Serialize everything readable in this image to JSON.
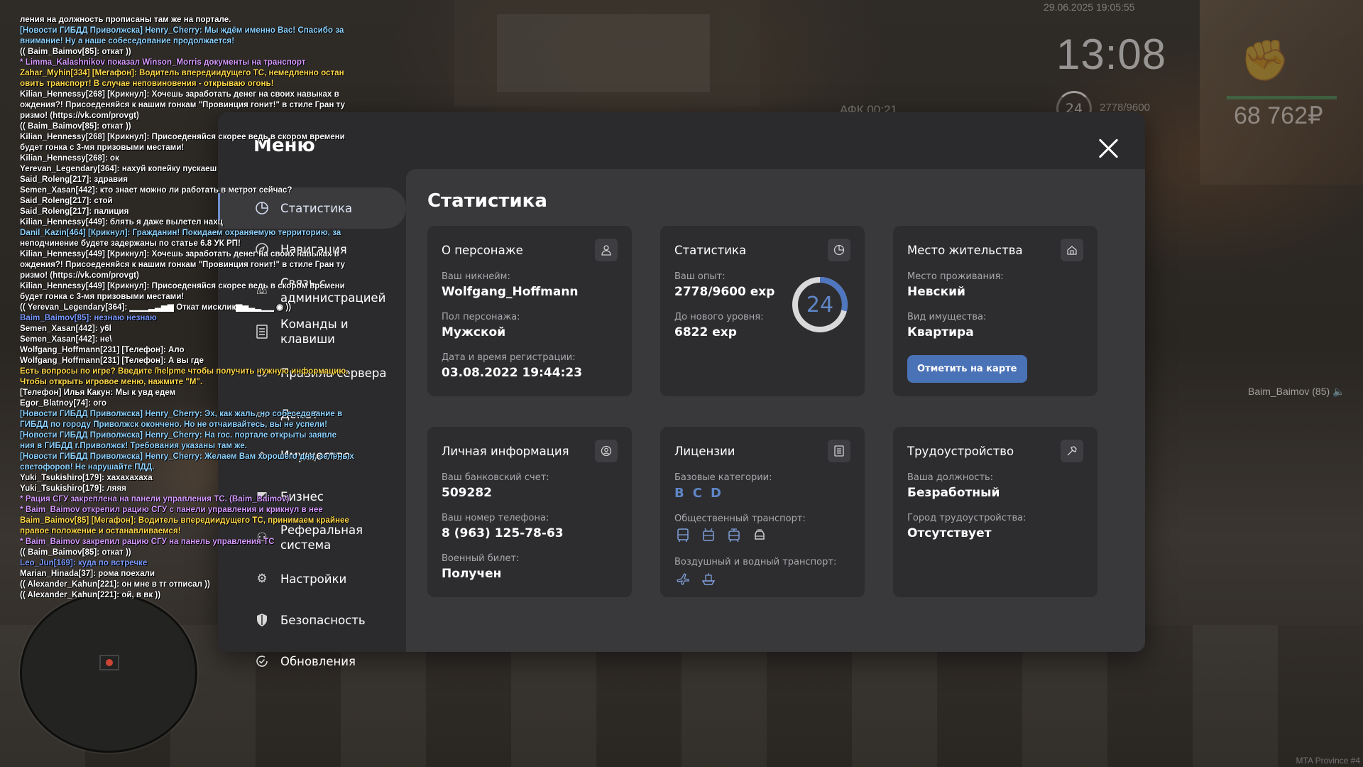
{
  "hud": {
    "datetime": "29.06.2025 19:05:55",
    "clock": "13:08",
    "afk": "АФК 00:21",
    "level": "24",
    "exp": "2778/9600",
    "money": "68 762₽",
    "voice_user": "Baim_Baimov (85)",
    "watermark": "MTA Province #4"
  },
  "chat": [
    {
      "text": "ления на должность прописаны там же на портале.",
      "color": "white"
    },
    {
      "text": "[Новости ГИБДД Приволжска] Henry_Cherry: Мы ждём именно Вас! Спасибо за",
      "color": "cyan"
    },
    {
      "text": " внимание! Ну а наше собеседование продолжается!",
      "color": "cyan"
    },
    {
      "text": "(( Baim_Baimov[85]: откат ))",
      "color": "white"
    },
    {
      "text": "* Limma_Kalashnikov показал Winson_Morris документы на транспорт",
      "color": "purple"
    },
    {
      "text": "Zahar_Myhin[334] [Мегафон]: Водитель впередиидущего ТС, немедленно остан",
      "color": "yellow"
    },
    {
      "text": "овить транспорт! В случае неповиновения - открываю огонь!",
      "color": "yellow"
    },
    {
      "text": "Kilian_Hennessy[268] [Крикнул]: Хочешь заработать денег на своих навыках в",
      "color": "white"
    },
    {
      "text": "ождения?! Присоеденяйся к нашим гонкам \"Провинция гонит!\" в стиле Гран ту",
      "color": "white"
    },
    {
      "text": "ризмо! (https://vk.com/provgt)",
      "color": "white"
    },
    {
      "text": "(( Baim_Baimov[85]: откат ))",
      "color": "white"
    },
    {
      "text": "Kilian_Hennessy[268] [Крикнул]: Присоеденяйся скорее ведь в скором времени",
      "color": "white"
    },
    {
      "text": " будет гонка с 3-мя призовыми местами!",
      "color": "white"
    },
    {
      "text": "Kilian_Hennessy[268]: ок",
      "color": "white"
    },
    {
      "text": "Yerevan_Legendary[364]: нахуй копейку пускаеш",
      "color": "white"
    },
    {
      "text": "Said_Roleng[217]: здравия",
      "color": "white"
    },
    {
      "text": "Semen_Xasan[442]: кто знает можно ли работать в метрот сейчас?",
      "color": "white"
    },
    {
      "text": "Said_Roleng[217]: стой",
      "color": "white"
    },
    {
      "text": "Said_Roleng[217]: палиция",
      "color": "white"
    },
    {
      "text": "Kilian_Hennessy[449]: блять я даже вылетел нахц",
      "color": "white"
    },
    {
      "text": "Danil_Kazin[464] [Крикнул]: Гражданин! Покидаем охраняемую территорию, за",
      "color": "cyan"
    },
    {
      "text": "неподчинение будете задержаны по статье 6.8 УК РП!",
      "color": "white"
    },
    {
      "text": "Kilian_Hennessy[449] [Крикнул]: Хочешь заработать денег на своих навыках в",
      "color": "white"
    },
    {
      "text": "ождения?! Присоеденяйся к нашим гонкам \"Провинция гонит!\" в стиле Гран ту",
      "color": "white"
    },
    {
      "text": "ризмо! (https://vk.com/provgt)",
      "color": "white"
    },
    {
      "text": "Kilian_Hennessy[449] [Крикнул]: Присоеденяйся скорее ведь в скором времени",
      "color": "white"
    },
    {
      "text": " будет гонка с 3-мя призовыми местами!",
      "color": "white"
    },
    {
      "text": "(( Yerevan_Legendary[364]: ▁▁▁▂▃▅▆ Откат мисклик▆▅▃▂▁▁ ◉ ))",
      "color": "white"
    },
    {
      "text": "Baim_Baimov[85]: незнаю незнаю",
      "color": "blue"
    },
    {
      "text": "Semen_Xasan[442]: у6l",
      "color": "white"
    },
    {
      "text": "Semen_Xasan[442]: не\\",
      "color": "white"
    },
    {
      "text": "Wolfgang_Hoffmann[231] [Телефон]: Ало",
      "color": "white"
    },
    {
      "text": "Wolfgang_Hoffmann[231] [Телефон]: А вы где",
      "color": "white"
    },
    {
      "text": "Есть вопросы по игре? Введите /helpme чтобы получить нужную информацию.",
      "color": "yellow"
    },
    {
      "text": "Чтобы открыть игровое меню, нажмите \"M\".",
      "color": "yellow"
    },
    {
      "text": "[Телефон] Илья Какун: Мы к увд едем",
      "color": "white"
    },
    {
      "text": "Egor_Blatnoy[74]: ого",
      "color": "white"
    },
    {
      "text": "[Новости ГИБДД Приволжска] Henry_Cherry: Эх, как жаль, но собеседование в",
      "color": "cyan"
    },
    {
      "text": " ГИБДД по городу Приволжск окончено. Но не отчаивайтесь, вы не успели!",
      "color": "cyan"
    },
    {
      "text": "[Новости ГИБДД Приволжска] Henry_Cherry: На гос. портале открыты заявле",
      "color": "cyan"
    },
    {
      "text": "ния в ГИБДД г.Приволжск! Требования указаны там же.",
      "color": "cyan"
    },
    {
      "text": "[Новости ГИБДД Приволжска] Henry_Cherry: Желаем Вам хорошего дня, зелёных",
      "color": "cyan"
    },
    {
      "text": " светофоров! Не нарушайте ПДД.",
      "color": "cyan"
    },
    {
      "text": "Yuki_Tsukishiro[179]: хахахахаха",
      "color": "white"
    },
    {
      "text": "Yuki_Tsukishiro[179]: ляяя",
      "color": "white"
    },
    {
      "text": "* Рация СГУ закреплена на панели управления ТС. (Baim_Baimov)",
      "color": "purple"
    },
    {
      "text": "* Baim_Baimov открепил рацию СГУ с панели управления и крикнул в нее",
      "color": "purple"
    },
    {
      "text": "Baim_Baimov[85] [Мегафон]: Водитель впередиидущего ТС, принимаем крайнее",
      "color": "yellow"
    },
    {
      "text": "правое положение и останавливаемся!",
      "color": "yellow"
    },
    {
      "text": "* Baim_Baimov закрепил рацию СГУ на панель управления ТС",
      "color": "purple"
    },
    {
      "text": "(( Baim_Baimov[85]: откат ))",
      "color": "white"
    },
    {
      "text": "Leo_Jun[169]: куда по встречке",
      "color": "blue"
    },
    {
      "text": "Marian_Hinada[37]: рома поехали",
      "color": "white"
    },
    {
      "text": "(( Alexander_Kahun[221]: он мне в тг отписал ))",
      "color": "white"
    },
    {
      "text": "(( Alexander_Kahun[221]: ой, в вк ))",
      "color": "white"
    }
  ],
  "menu": {
    "title": "Меню",
    "nav": [
      {
        "label": "Статистика",
        "icon": "pie-chart-icon",
        "active": true
      },
      {
        "label": "Навигация",
        "icon": "compass-icon"
      },
      {
        "label": "Связь с администрацией",
        "icon": "phone-icon"
      },
      {
        "label": "Команды и клавиши",
        "icon": "document-list-icon"
      },
      {
        "label": "Правила сервера",
        "icon": "scales-icon"
      },
      {
        "label": "Донат",
        "icon": "wallet-icon"
      },
      {
        "label": "Имущество",
        "icon": "house-icon"
      },
      {
        "label": "Бизнес",
        "icon": "briefcase-icon"
      },
      {
        "label": "Реферальная система",
        "icon": "people-icon"
      },
      {
        "label": "Настройки",
        "icon": "gear-icon"
      },
      {
        "label": "Безопасность",
        "icon": "shield-icon"
      },
      {
        "label": "Обновления",
        "icon": "refresh-check-icon"
      }
    ]
  },
  "stats": {
    "title": "Статистика",
    "character": {
      "title": "О персонаже",
      "nick_label": "Ваш никнейм:",
      "nick": "Wolfgang_Hoffmann",
      "gender_label": "Пол персонажа:",
      "gender": "Мужской",
      "reg_label": "Дата и время регистрации:",
      "reg": "03.08.2022 19:44:23"
    },
    "statistics": {
      "title": "Статистика",
      "exp_label": "Ваш опыт:",
      "exp": "2778/9600 exp",
      "next_label": "До нового уровня:",
      "next": "6822 exp",
      "level": "24",
      "progress": 0.289
    },
    "residence": {
      "title": "Место жительства",
      "place_label": "Место проживания:",
      "place": "Невский",
      "type_label": "Вид имущества:",
      "type": "Квартира",
      "button": "Отметить на карте"
    },
    "personal": {
      "title": "Личная информация",
      "bank_label": "Ваш банковский счет:",
      "bank": "509282",
      "phone_label": "Ваш номер телефона:",
      "phone": "8 (963) 125-78-63",
      "military_label": "Военный билет:",
      "military": "Получен"
    },
    "licenses": {
      "title": "Лицензии",
      "base_label": "Базовые категории:",
      "categories": [
        "B",
        "C",
        "D"
      ],
      "public_label": "Общественный транспорт:",
      "air_label": "Воздушный и водный транспорт:"
    },
    "employment": {
      "title": "Трудоустройство",
      "position_label": "Ваша должность:",
      "position": "Безработный",
      "city_label": "Город трудоустройства:",
      "city": "Отсутствует"
    }
  }
}
